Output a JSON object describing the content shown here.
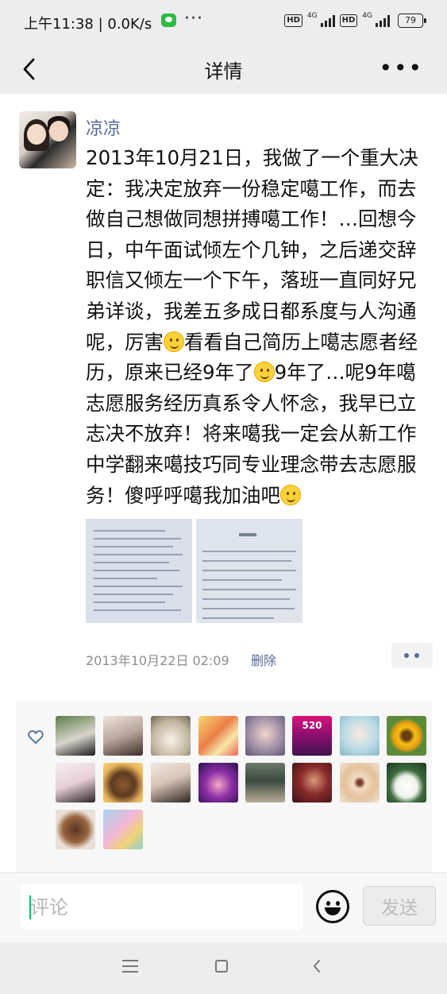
{
  "status_bar": {
    "time": "上午11:38 | 0.0K/s",
    "network": "4G",
    "hd": "HD",
    "battery": "79",
    "more": "···"
  },
  "nav": {
    "title": "详情",
    "more": "•••"
  },
  "post": {
    "author": "凉凉",
    "text_segments": [
      "2013年10月21日，我做了一个重大决定：我决定放弃一份稳定噶工作，而去做自己想做同想拼搏噶工作！…回想今日，中午面试倾左个几钟，之后递交辞职信又倾左一个下午，落班一直同好兄弟详谈，我差五多成日都系度与人沟通呢，厉害",
      "看看自己简历上噶志愿者经历，原来已经9年了",
      "9年了…呢9年噶志愿服务经历真系令人怀念，我早已立志决不放弃！将来噶我一定会从新工作中学翻来噶技巧同专业理念带去志愿服务！傻呼呼噶我加油吧"
    ],
    "time": "2013年10月22日 02:09",
    "delete_label": "删除"
  },
  "likes": {
    "icon": "heart-outline-icon",
    "badge_text": "520",
    "count": 18
  },
  "comment_bar": {
    "placeholder": "评论",
    "send_label": "发送"
  },
  "colors": {
    "link": "#576b95",
    "accent": "#07c160",
    "background": "#ededed"
  }
}
